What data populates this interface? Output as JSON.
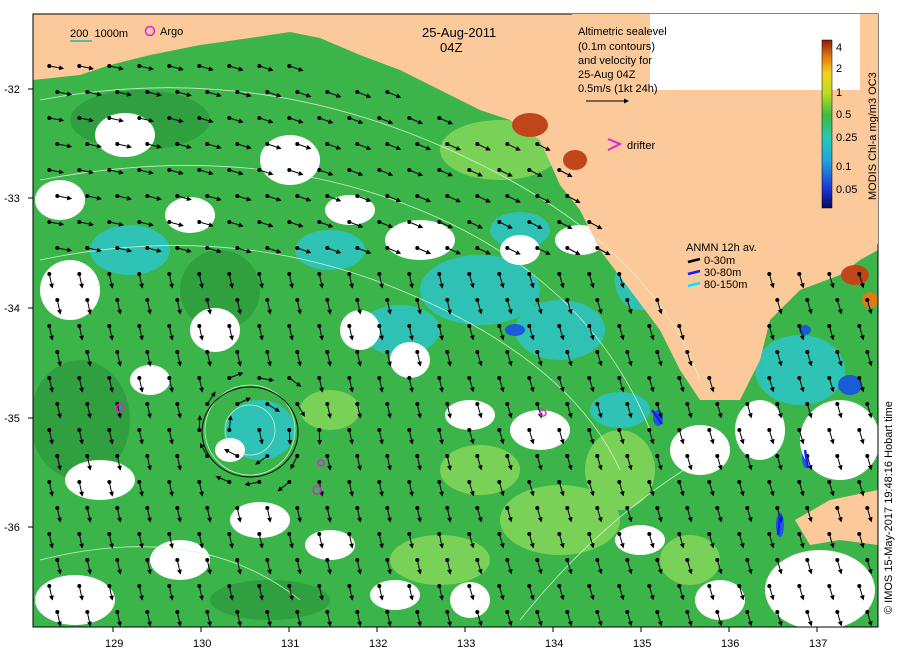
{
  "header": {
    "date": "25-Aug-2011",
    "time": "04Z",
    "scale_label": "200  1000m",
    "argo_label": "Argo"
  },
  "info": {
    "lines": [
      "Altimetric sealevel",
      "(0.1m contours)",
      "and velocity for",
      "25-Aug 04Z",
      "0.5m/s (1kt 24h)"
    ],
    "drifter_label": "drifter"
  },
  "anmn": {
    "title": "ANMN 12h av.",
    "items": [
      {
        "label": "0-30m",
        "color": "#000000"
      },
      {
        "label": "30-80m",
        "color": "#1a1aff"
      },
      {
        "label": "80-150m",
        "color": "#00e5ff"
      }
    ]
  },
  "colorbar": {
    "title": "MODIS Chl-a mg/m3 OC3",
    "ticks": [
      "4",
      "2",
      "1",
      "0.5",
      "0.25",
      "0.1",
      "0.05"
    ]
  },
  "credit": "© IMOS 15-May-2017 19:48:16 Hobart time",
  "axes": {
    "x_ticks": [
      "129",
      "130",
      "131",
      "132",
      "133",
      "134",
      "135",
      "136",
      "137"
    ],
    "y_ticks": [
      "-32",
      "-33",
      "-34",
      "-35",
      "-36"
    ]
  },
  "colors": {
    "land": "#fcc99a",
    "chl_green": "#3bb54a",
    "chl_light": "#7ed957",
    "chl_cyan": "#26c6c6",
    "cloud": "#ffffff"
  }
}
